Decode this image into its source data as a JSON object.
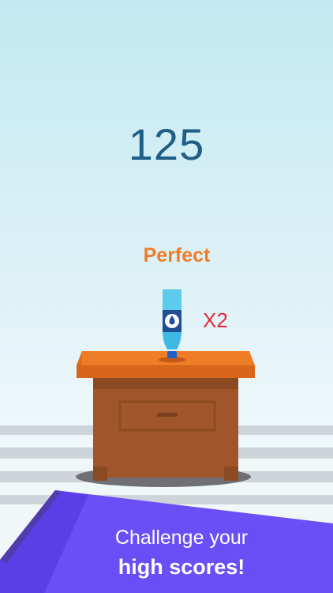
{
  "game": {
    "score": "125",
    "feedback": "Perfect",
    "multiplier": "X2"
  },
  "promo": {
    "line1": "Challenge your",
    "line2": "high scores!"
  },
  "colors": {
    "score": "#1f5f87",
    "feedback": "#ef7c27",
    "multiplier": "#e02c3c",
    "banner": "#6a4ef6",
    "table_top": "#ef7c27",
    "cabinet": "#a0562a",
    "bottle": "#3fb8e4"
  },
  "icons": [
    "water-drop-icon"
  ]
}
